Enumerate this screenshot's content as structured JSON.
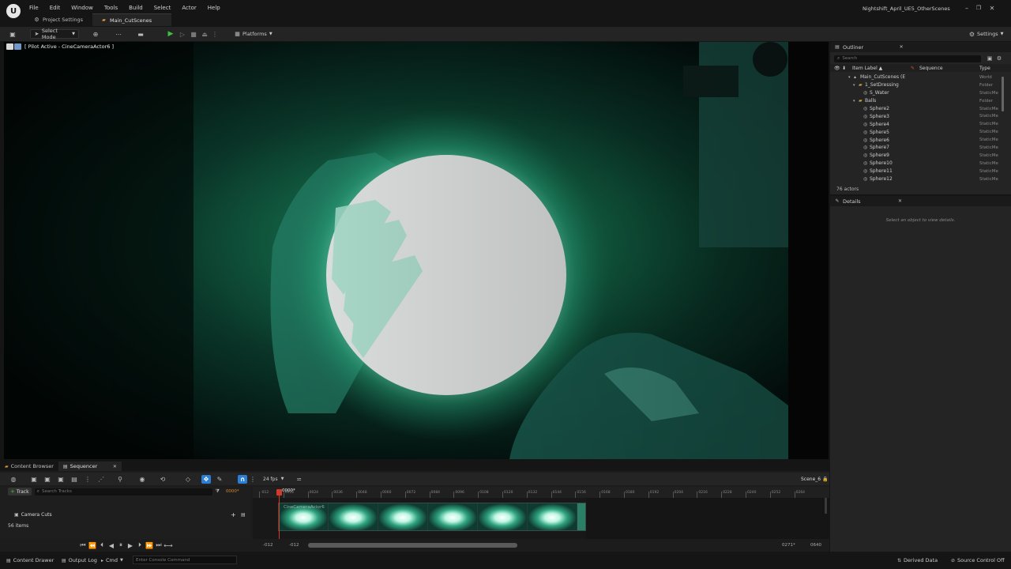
{
  "menu": {
    "items": [
      "File",
      "Edit",
      "Window",
      "Tools",
      "Build",
      "Select",
      "Actor",
      "Help"
    ]
  },
  "window": {
    "title": "Nightshift_April_UE5_OtherScenes"
  },
  "tabs": {
    "project_settings": "Project Settings",
    "level": "Main_CutScenes"
  },
  "toolbar": {
    "select_mode": "Select Mode",
    "platforms": "Platforms",
    "settings": "Settings"
  },
  "viewport": {
    "pilot_label": "[ Pilot Active - CineCameraActor6 ]"
  },
  "outliner": {
    "title": "Outliner",
    "search_placeholder": "Search",
    "col_label": "Item Label ▲",
    "col_sequence": "Sequence",
    "col_type": "Type",
    "rows": [
      {
        "label": "Main_CutScenes (E",
        "type": "World",
        "indent": 0,
        "icon": "world"
      },
      {
        "label": "1_SetDressing",
        "type": "Folder",
        "indent": 1,
        "icon": "folder"
      },
      {
        "label": "S_Water",
        "type": "StaticMe",
        "indent": 2,
        "icon": "mesh"
      },
      {
        "label": "Balls",
        "type": "Folder",
        "indent": 1,
        "icon": "folder"
      },
      {
        "label": "Sphere2",
        "type": "StaticMe",
        "indent": 2,
        "icon": "mesh"
      },
      {
        "label": "Sphere3",
        "type": "StaticMe",
        "indent": 2,
        "icon": "mesh"
      },
      {
        "label": "Sphere4",
        "type": "StaticMe",
        "indent": 2,
        "icon": "mesh"
      },
      {
        "label": "Sphere5",
        "type": "StaticMe",
        "indent": 2,
        "icon": "mesh"
      },
      {
        "label": "Sphere6",
        "type": "StaticMe",
        "indent": 2,
        "icon": "mesh"
      },
      {
        "label": "Sphere7",
        "type": "StaticMe",
        "indent": 2,
        "icon": "mesh"
      },
      {
        "label": "Sphere9",
        "type": "StaticMe",
        "indent": 2,
        "icon": "mesh"
      },
      {
        "label": "Sphere10",
        "type": "StaticMe",
        "indent": 2,
        "icon": "mesh"
      },
      {
        "label": "Sphere11",
        "type": "StaticMe",
        "indent": 2,
        "icon": "mesh"
      },
      {
        "label": "Sphere12",
        "type": "StaticMe",
        "indent": 2,
        "icon": "mesh"
      }
    ],
    "actor_count": "76 actors"
  },
  "details": {
    "title": "Details",
    "empty_text": "Select an object to view details."
  },
  "sequencer": {
    "tab_content_browser": "Content Browser",
    "tab_sequencer": "Sequencer",
    "fps": "24 fps",
    "sequence_name": "Scene_6",
    "current_frame": "0000*",
    "playhead_label": "0000*",
    "add_track": "Track",
    "search_placeholder": "Search Tracks",
    "camera_cuts": "Camera Cuts",
    "item_count": "56 items",
    "clip_label": "CineCameraActor6",
    "ruler_ticks": [
      "-012",
      "0012",
      "0024",
      "0036",
      "0048",
      "0060",
      "0072",
      "0084",
      "0096",
      "0108",
      "0120",
      "0132",
      "0144",
      "0156",
      "0168",
      "0180",
      "0192",
      "0204",
      "0216",
      "0228",
      "0240",
      "0252",
      "0264"
    ],
    "range_start": "-012",
    "range_start2": "-012",
    "range_end": "0271*",
    "range_end2": "0640"
  },
  "statusbar": {
    "content_drawer": "Content Drawer",
    "output_log": "Output Log",
    "cmd": "Cmd",
    "console_placeholder": "Enter Console Command",
    "derived_data": "Derived Data",
    "source_control": "Source Control Off"
  },
  "colors": {
    "accent_blue": "#2a7fd4",
    "playhead_red": "#d23b2c",
    "glow": "#6ff0c4",
    "play_green": "#3fbf3f"
  }
}
